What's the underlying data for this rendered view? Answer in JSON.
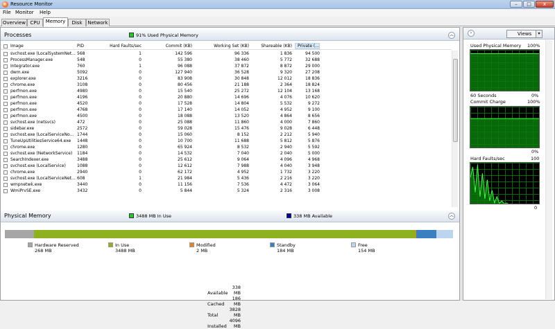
{
  "window": {
    "title": "Resource Monitor",
    "min": "–",
    "max": "□",
    "close": "x"
  },
  "menu": [
    "File",
    "Monitor",
    "Help"
  ],
  "tabs": [
    "Overview",
    "CPU",
    "Memory",
    "Disk",
    "Network"
  ],
  "processes": {
    "title": "Processes",
    "legend": "91% Used Physical Memory",
    "legend_color": "#22cc22",
    "columns": [
      "Image",
      "PID",
      "Hard Faults/sec",
      "Commit (KB)",
      "Working Set (KB)",
      "Shareable (KB)",
      "Private (..."
    ],
    "rows": [
      [
        "svchost.exe (LocalSystemNet...",
        "568",
        "1",
        "142 596",
        "96 336",
        "1 836",
        "94 500"
      ],
      [
        "ProcessManager.exe",
        "548",
        "0",
        "55 380",
        "38 460",
        "5 772",
        "32 688"
      ],
      [
        "Integrator.exe",
        "760",
        "1",
        "96 088",
        "37 872",
        "8 872",
        "29 000"
      ],
      [
        "dwm.exe",
        "5092",
        "0",
        "127 940",
        "36 528",
        "9 320",
        "27 208"
      ],
      [
        "explorer.exe",
        "3216",
        "0",
        "83 908",
        "30 848",
        "12 012",
        "18 836"
      ],
      [
        "chrome.exe",
        "3108",
        "0",
        "80 456",
        "21 188",
        "2 364",
        "18 824"
      ],
      [
        "perfmon.exe",
        "4980",
        "0",
        "15 540",
        "25 272",
        "12 104",
        "13 168"
      ],
      [
        "perfmon.exe",
        "4196",
        "0",
        "20 880",
        "14 696",
        "4 076",
        "10 620"
      ],
      [
        "perfmon.exe",
        "4520",
        "0",
        "17 528",
        "14 804",
        "5 532",
        "9 272"
      ],
      [
        "perfmon.exe",
        "4768",
        "0",
        "17 140",
        "14 052",
        "4 952",
        "9 100"
      ],
      [
        "perfmon.exe",
        "4500",
        "0",
        "18 088",
        "13 520",
        "4 864",
        "8 656"
      ],
      [
        "svchost.exe (netsvcs)",
        "472",
        "0",
        "25 088",
        "11 860",
        "4 000",
        "7 860"
      ],
      [
        "sidebar.exe",
        "2572",
        "0",
        "59 028",
        "15 476",
        "9 028",
        "6 448"
      ],
      [
        "svchost.exe (LocalServiceNo...",
        "1744",
        "0",
        "15 060",
        "8 152",
        "2 212",
        "5 940"
      ],
      [
        "TuneUpUtilitiesService64.exe",
        "1448",
        "0",
        "10 700",
        "11 688",
        "5 812",
        "5 876"
      ],
      [
        "chrome.exe",
        "1280",
        "0",
        "65 924",
        "8 532",
        "2 940",
        "5 592"
      ],
      [
        "svchost.exe (NetworkService)",
        "1184",
        "0",
        "14 532",
        "7 040",
        "2 040",
        "5 000"
      ],
      [
        "SearchIndexer.exe",
        "3488",
        "0",
        "25 612",
        "9 064",
        "4 096",
        "4 968"
      ],
      [
        "svchost.exe (LocalService)",
        "1088",
        "0",
        "12 612",
        "7 988",
        "4 040",
        "3 948"
      ],
      [
        "chrome.exe",
        "2940",
        "0",
        "62 172",
        "4 952",
        "1 732",
        "3 220"
      ],
      [
        "svchost.exe (LocalServiceNet...",
        "608",
        "1",
        "21 984",
        "5 436",
        "2 216",
        "3 220"
      ],
      [
        "wmpnetwk.exe",
        "3440",
        "0",
        "11 156",
        "7 536",
        "4 472",
        "3 064"
      ],
      [
        "WmiPrvSE.exe",
        "3432",
        "0",
        "5 844",
        "5 324",
        "2 316",
        "3 008"
      ]
    ]
  },
  "physical": {
    "title": "Physical Memory",
    "legend_inuse": "3488 MB In Use",
    "legend_available": "338 MB Available",
    "inuse_color": "#22cc22",
    "available_color": "#0000aa",
    "bar": [
      {
        "mb": 268,
        "color": "#a6a6a6"
      },
      {
        "mb": 3488,
        "color": "#8db21d"
      },
      {
        "mb": 2,
        "color": "#e8821c"
      },
      {
        "mb": 184,
        "color": "#3a7fc0"
      },
      {
        "mb": 154,
        "color": "#bcd5ee"
      }
    ],
    "legend": [
      {
        "label": "Hardware Reserved",
        "value": "268 MB",
        "color": "#a6a6a6"
      },
      {
        "label": "In Use",
        "value": "3488 MB",
        "color": "#8db21d"
      },
      {
        "label": "Modified",
        "value": "2 MB",
        "color": "#e8821c"
      },
      {
        "label": "Standby",
        "value": "184 MB",
        "color": "#3a7fc0"
      },
      {
        "label": "Free",
        "value": "154 MB",
        "color": "#bcd5ee"
      }
    ],
    "stats": [
      {
        "label": "Available",
        "value": "338 MB"
      },
      {
        "label": "Cached",
        "value": "186 MB"
      },
      {
        "label": "Total",
        "value": "3828 MB"
      },
      {
        "label": "Installed",
        "value": "4096 MB"
      }
    ]
  },
  "right": {
    "views": "Views",
    "graphs": [
      {
        "title": "Used Physical Memory",
        "max": "100%",
        "footer_left": "60 Seconds",
        "footer_right": "0%",
        "level": 0.91
      },
      {
        "title": "Commit Charge",
        "max": "100%",
        "footer_left": "",
        "footer_right": "0%",
        "level": 0.72
      },
      {
        "title": "Hard Faults/sec",
        "max": "100",
        "footer_left": "",
        "footer_right": "0",
        "level": 0
      }
    ]
  }
}
